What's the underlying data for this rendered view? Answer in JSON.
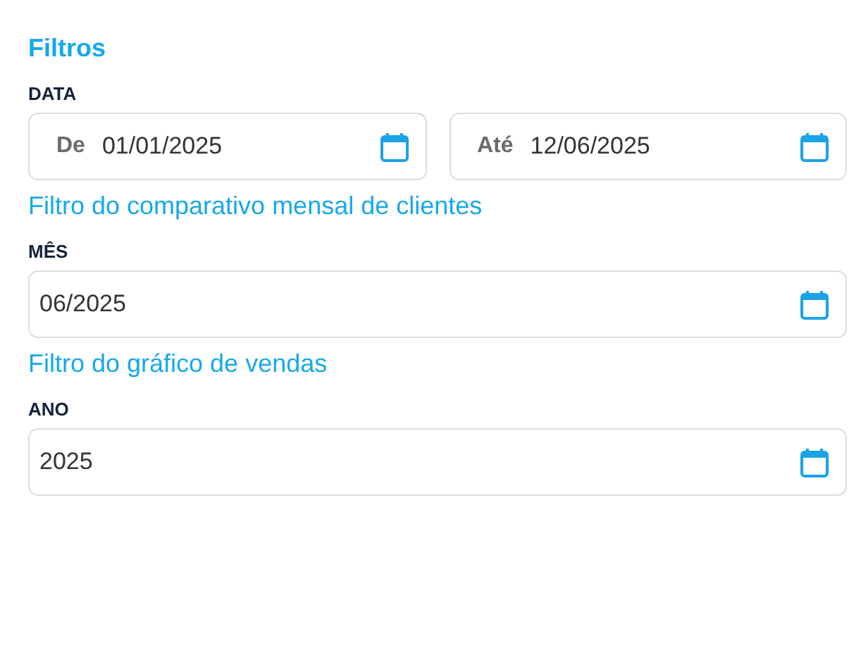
{
  "title": "Filtros",
  "sections": [
    {
      "label": "DATA",
      "fields": [
        {
          "prefix": "De",
          "value": "01/01/2025"
        },
        {
          "prefix": "Até",
          "value": "12/06/2025"
        }
      ]
    },
    {
      "heading": "Filtro do comparativo mensal de clientes",
      "label": "MÊS",
      "fields": [
        {
          "value": "06/2025"
        }
      ]
    },
    {
      "heading": "Filtro do gráfico de vendas",
      "label": "ANO",
      "fields": [
        {
          "value": "2025"
        }
      ]
    }
  ]
}
